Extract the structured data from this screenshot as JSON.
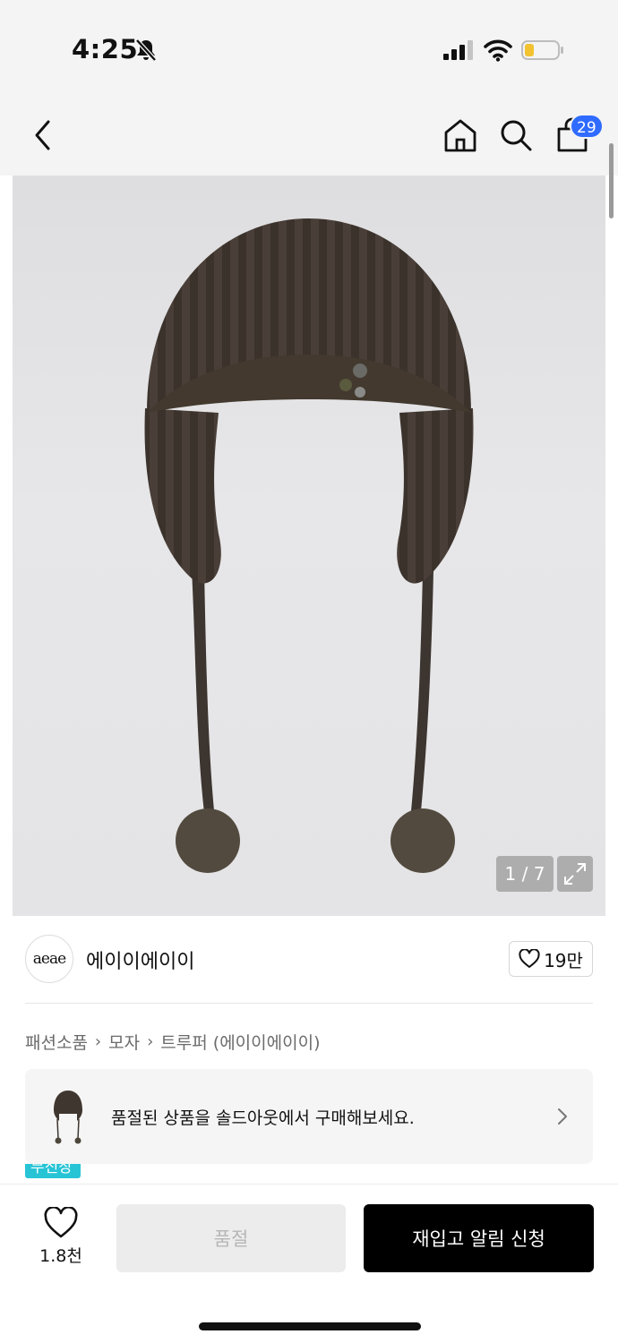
{
  "status_bar": {
    "time": "4:25"
  },
  "nav": {
    "cart_count": "29"
  },
  "gallery": {
    "counter": "1 / 7"
  },
  "brand": {
    "logo_text": "aeae",
    "name": "에이이에이이",
    "likes": "19만"
  },
  "breadcrumb": [
    "패션소품",
    "모자",
    "트루퍼 (에이이에이이)"
  ],
  "banner": {
    "text": "품절된 상품을 솔드아웃에서 구매해보세요.",
    "tag_label": "무진장"
  },
  "bottom": {
    "wish_count": "1.8천",
    "soldout_label": "품절",
    "restock_label": "재입고 알림 신청"
  },
  "colors": {
    "accent_blue": "#2f6bff",
    "tag_cyan": "#27c4d6",
    "button_black": "#000000"
  }
}
